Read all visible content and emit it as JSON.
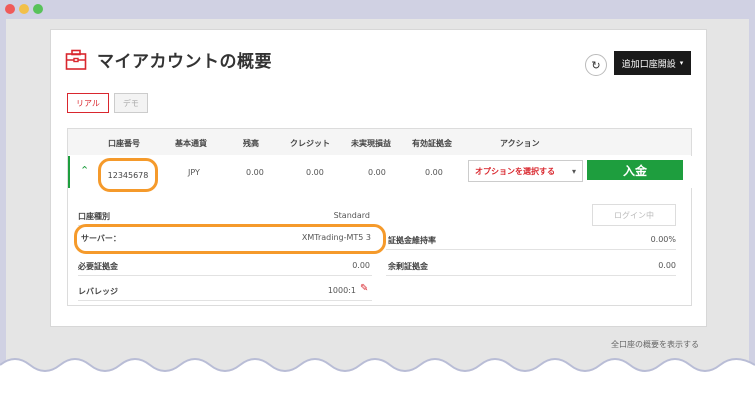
{
  "header": {
    "title": "マイアカウントの概要",
    "add_account_label": "追加口座開設",
    "refresh_icon": "refresh-icon",
    "wallet_icon": "wallet-icon"
  },
  "tabs": [
    {
      "label": "リアル",
      "active": true
    },
    {
      "label": "デモ",
      "active": false
    }
  ],
  "table": {
    "columns": [
      "口座番号",
      "基本通貨",
      "残高",
      "クレジット",
      "未実現損益",
      "有効証拠金",
      "アクション"
    ],
    "row": {
      "account_number": "12345678",
      "currency": "JPY",
      "balance": "0.00",
      "credit": "0.00",
      "unrealized": "0.00",
      "equity": "0.00",
      "action_select": "オプションを選択する",
      "deposit_label": "入金"
    }
  },
  "details": {
    "account_type_label": "口座種別",
    "account_type_value": "Standard",
    "login_button": "ログイン中",
    "server_label": "サーバー：",
    "server_value": "XMTrading-MT5 3",
    "maintenance_margin_label": "証拠金維持率",
    "maintenance_margin_value": "0.00%",
    "required_margin_label": "必要証拠金",
    "required_margin_value": "0.00",
    "free_margin_label": "余剰証拠金",
    "free_margin_value": "0.00",
    "leverage_label": "レバレッジ",
    "leverage_value": "1000:1"
  },
  "footer": {
    "all_accounts_link": "全口座の概要を表示する"
  },
  "colors": {
    "accent_red": "#d9272e",
    "green": "#1e9e3e",
    "highlight_orange": "#f59a2b"
  }
}
